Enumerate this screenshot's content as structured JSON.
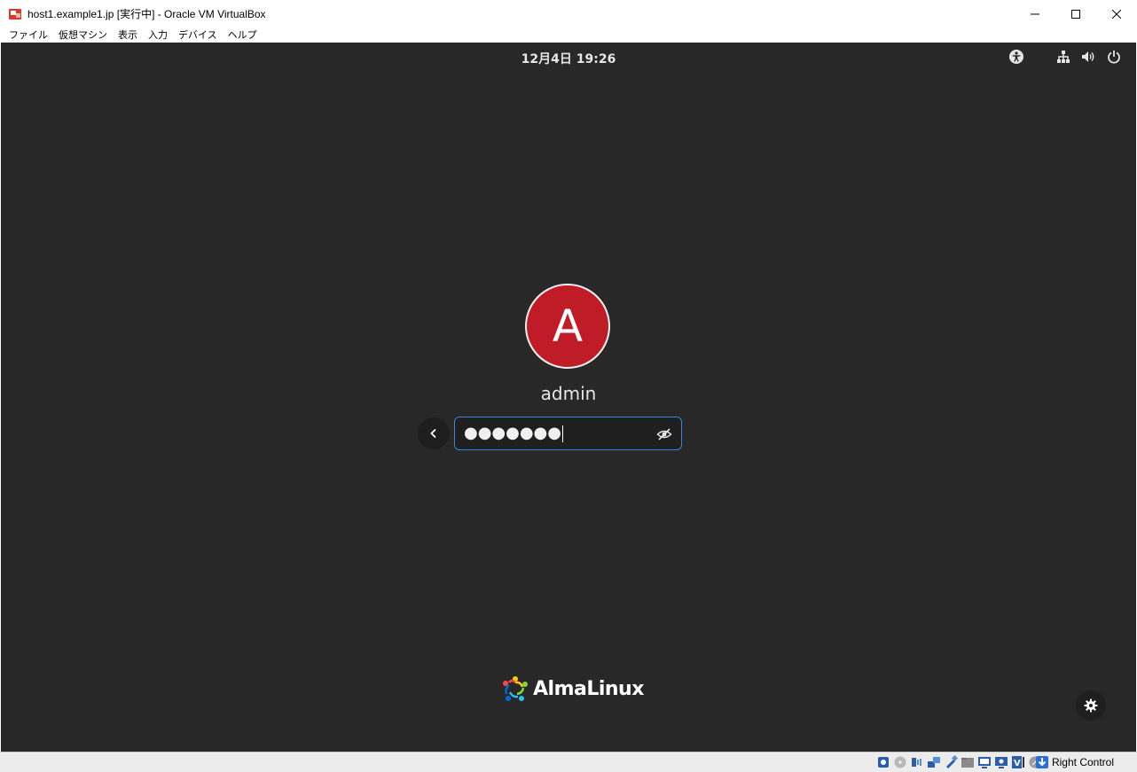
{
  "window": {
    "title": "host1.example1.jp [実行中] - Oracle VM VirtualBox",
    "controls": [
      "minimize",
      "maximize",
      "close"
    ]
  },
  "menubar": {
    "items": [
      {
        "label": "ファイル"
      },
      {
        "label": "仮想マシン"
      },
      {
        "label": "表示"
      },
      {
        "label": "入力"
      },
      {
        "label": "デバイス"
      },
      {
        "label": "ヘルプ"
      }
    ]
  },
  "topbar": {
    "clock": "12月4日  19:26",
    "icons": [
      "accessibility-icon",
      "network-icon",
      "volume-icon",
      "power-icon"
    ]
  },
  "login": {
    "avatar_letter": "A",
    "avatar_color": "#c01c28",
    "username": "admin",
    "password_masked": "●●●●●●●",
    "focus_color": "#3584e4"
  },
  "branding": {
    "logo_text": "AlmaLinux"
  },
  "statusbar": {
    "host_key": "Right Control",
    "icons": [
      "hard-disk-icon",
      "optical-drive-icon",
      "audio-icon",
      "network-adapter-icon",
      "usb-icon",
      "shared-folders-icon",
      "display-icon",
      "recording-icon",
      "cpu-virtualization-icon",
      "mouse-integration-icon"
    ]
  }
}
